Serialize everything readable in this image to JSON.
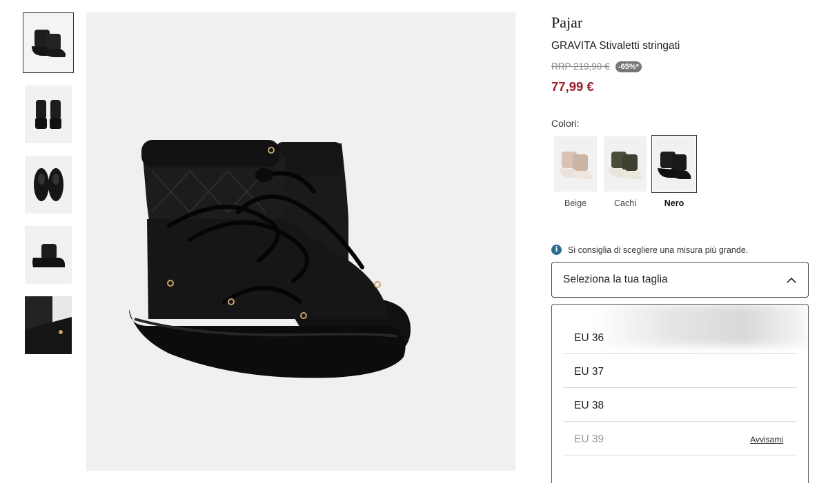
{
  "product": {
    "brand": "Pajar",
    "name": "GRAVITA Stivaletti stringati",
    "rrp": "RRP 219,90 €",
    "discount": "-65%*",
    "price": "77,99 €"
  },
  "colors": {
    "label": "Colori:",
    "options": [
      {
        "name": "Beige",
        "selected": false,
        "tone": "#d9c3b4"
      },
      {
        "name": "Cachi",
        "selected": false,
        "tone": "#4a4d3a"
      },
      {
        "name": "Nero",
        "selected": true,
        "tone": "#1b1b1b"
      }
    ]
  },
  "size": {
    "advice": "Si consiglia di scegliere una misura più grande.",
    "select_label": "Seleziona la tua taglia",
    "options": [
      {
        "label": "EU 36",
        "available": true
      },
      {
        "label": "EU 37",
        "available": true
      },
      {
        "label": "EU 38",
        "available": true
      },
      {
        "label": "EU 39",
        "available": false,
        "action": "Avvisami"
      }
    ]
  },
  "gallery": {
    "thumbnails": [
      "front-pair",
      "back-view",
      "top-view",
      "side-view",
      "detail-view"
    ],
    "active_index": 0
  },
  "theme": {
    "price_color": "#9b1b2a",
    "info_color": "#2b6d8f",
    "badge_color": "#777777"
  }
}
